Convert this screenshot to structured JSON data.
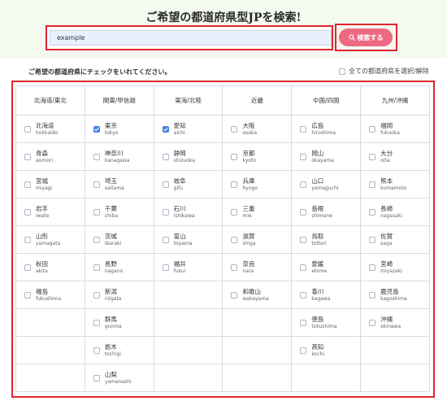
{
  "page": {
    "title": "ご希望の都道府県型JPを検索!"
  },
  "search": {
    "value": "example",
    "button_label": "検索する",
    "icon": "search-icon"
  },
  "instruction": "ご希望の都道府県にチェックをいれてください。",
  "select_all": {
    "label": "全ての都道府県を選択/解除",
    "checked": false
  },
  "colors": {
    "accent": "#ee6a82",
    "highlight": "#e0262b",
    "checkbox_on": "#4a7fe0",
    "hero_bg": "#f4faf0"
  },
  "regions": [
    {
      "name": "北海道/東北",
      "prefectures": [
        {
          "jp": "北海道",
          "romaji": "hokkaido",
          "checked": false
        },
        {
          "jp": "青森",
          "romaji": "aomori",
          "checked": false
        },
        {
          "jp": "宮城",
          "romaji": "miyagi",
          "checked": false
        },
        {
          "jp": "岩手",
          "romaji": "iwate",
          "checked": false
        },
        {
          "jp": "山形",
          "romaji": "yamagata",
          "checked": false
        },
        {
          "jp": "秋田",
          "romaji": "akita",
          "checked": false
        },
        {
          "jp": "福島",
          "romaji": "fukushima",
          "checked": false
        }
      ]
    },
    {
      "name": "関東/甲信越",
      "prefectures": [
        {
          "jp": "東京",
          "romaji": "tokyo",
          "checked": true
        },
        {
          "jp": "神奈川",
          "romaji": "kanagawa",
          "checked": false
        },
        {
          "jp": "埼玉",
          "romaji": "saitama",
          "checked": false
        },
        {
          "jp": "千葉",
          "romaji": "chiba",
          "checked": false
        },
        {
          "jp": "茨城",
          "romaji": "ibaraki",
          "checked": false
        },
        {
          "jp": "長野",
          "romaji": "nagano",
          "checked": false
        },
        {
          "jp": "新潟",
          "romaji": "niigata",
          "checked": false
        },
        {
          "jp": "群馬",
          "romaji": "gunma",
          "checked": false
        },
        {
          "jp": "栃木",
          "romaji": "tochigi",
          "checked": false
        },
        {
          "jp": "山梨",
          "romaji": "yamanashi",
          "checked": false
        }
      ]
    },
    {
      "name": "東海/北陸",
      "prefectures": [
        {
          "jp": "愛知",
          "romaji": "aichi",
          "checked": true
        },
        {
          "jp": "静岡",
          "romaji": "shizuoka",
          "checked": false
        },
        {
          "jp": "岐阜",
          "romaji": "gifu",
          "checked": false
        },
        {
          "jp": "石川",
          "romaji": "ishikawa",
          "checked": false
        },
        {
          "jp": "富山",
          "romaji": "toyama",
          "checked": false
        },
        {
          "jp": "福井",
          "romaji": "fukui",
          "checked": false
        }
      ]
    },
    {
      "name": "近畿",
      "prefectures": [
        {
          "jp": "大阪",
          "romaji": "osaka",
          "checked": false
        },
        {
          "jp": "京都",
          "romaji": "kyoto",
          "checked": false
        },
        {
          "jp": "兵庫",
          "romaji": "hyogo",
          "checked": false
        },
        {
          "jp": "三重",
          "romaji": "mie",
          "checked": false
        },
        {
          "jp": "滋賀",
          "romaji": "shiga",
          "checked": false
        },
        {
          "jp": "奈良",
          "romaji": "nara",
          "checked": false
        },
        {
          "jp": "和歌山",
          "romaji": "wakayama",
          "checked": false
        }
      ]
    },
    {
      "name": "中国/四国",
      "prefectures": [
        {
          "jp": "広島",
          "romaji": "hiroshima",
          "checked": false
        },
        {
          "jp": "岡山",
          "romaji": "okayama",
          "checked": false
        },
        {
          "jp": "山口",
          "romaji": "yamaguchi",
          "checked": false
        },
        {
          "jp": "島根",
          "romaji": "shimane",
          "checked": false
        },
        {
          "jp": "鳥取",
          "romaji": "tottori",
          "checked": false
        },
        {
          "jp": "愛媛",
          "romaji": "ehime",
          "checked": false
        },
        {
          "jp": "香川",
          "romaji": "kagawa",
          "checked": false
        },
        {
          "jp": "徳島",
          "romaji": "tokushima",
          "checked": false
        },
        {
          "jp": "高知",
          "romaji": "kochi",
          "checked": false
        }
      ]
    },
    {
      "name": "九州/沖縄",
      "prefectures": [
        {
          "jp": "福岡",
          "romaji": "fukuoka",
          "checked": false
        },
        {
          "jp": "大分",
          "romaji": "oita",
          "checked": false
        },
        {
          "jp": "熊本",
          "romaji": "kumamoto",
          "checked": false
        },
        {
          "jp": "長崎",
          "romaji": "nagasaki",
          "checked": false
        },
        {
          "jp": "佐賀",
          "romaji": "saga",
          "checked": false
        },
        {
          "jp": "宮崎",
          "romaji": "miyazaki",
          "checked": false
        },
        {
          "jp": "鹿児島",
          "romaji": "kagoshima",
          "checked": false
        },
        {
          "jp": "沖縄",
          "romaji": "okinawa",
          "checked": false
        }
      ]
    }
  ]
}
